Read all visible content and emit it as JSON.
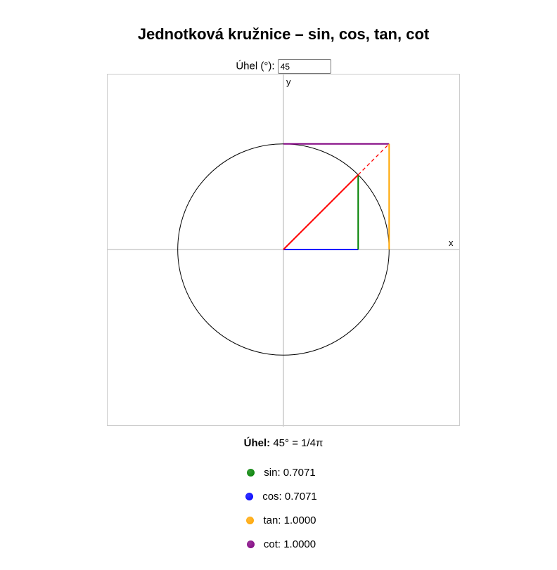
{
  "title": "Jednotková kružnice – sin, cos, tan, cot",
  "angle_input": {
    "label": "Úhel (°):",
    "value": "45"
  },
  "axes": {
    "x_label": "x",
    "y_label": "y"
  },
  "summary": {
    "label": "Úhel:",
    "value": "45° = 1/4π"
  },
  "readouts": [
    {
      "name": "sin",
      "text": "sin: 0.7071",
      "color": "#008000"
    },
    {
      "name": "cos",
      "text": "cos: 0.7071",
      "color": "#0000ff"
    },
    {
      "name": "tan",
      "text": "tan: 1.0000",
      "color": "#ffa500"
    },
    {
      "name": "cot",
      "text": "cot: 1.0000",
      "color": "#800080"
    }
  ],
  "diagram": {
    "angle_deg": 45,
    "radius": 1,
    "view_range": [
      -1.67,
      1.67
    ],
    "colors": {
      "radius": "#ff0000",
      "sin": "#008000",
      "cos": "#0000ff",
      "tan": "#ffa500",
      "cot": "#800080",
      "circle": "#000000",
      "axes": "#cccccc",
      "frame": "#cccccc"
    }
  }
}
